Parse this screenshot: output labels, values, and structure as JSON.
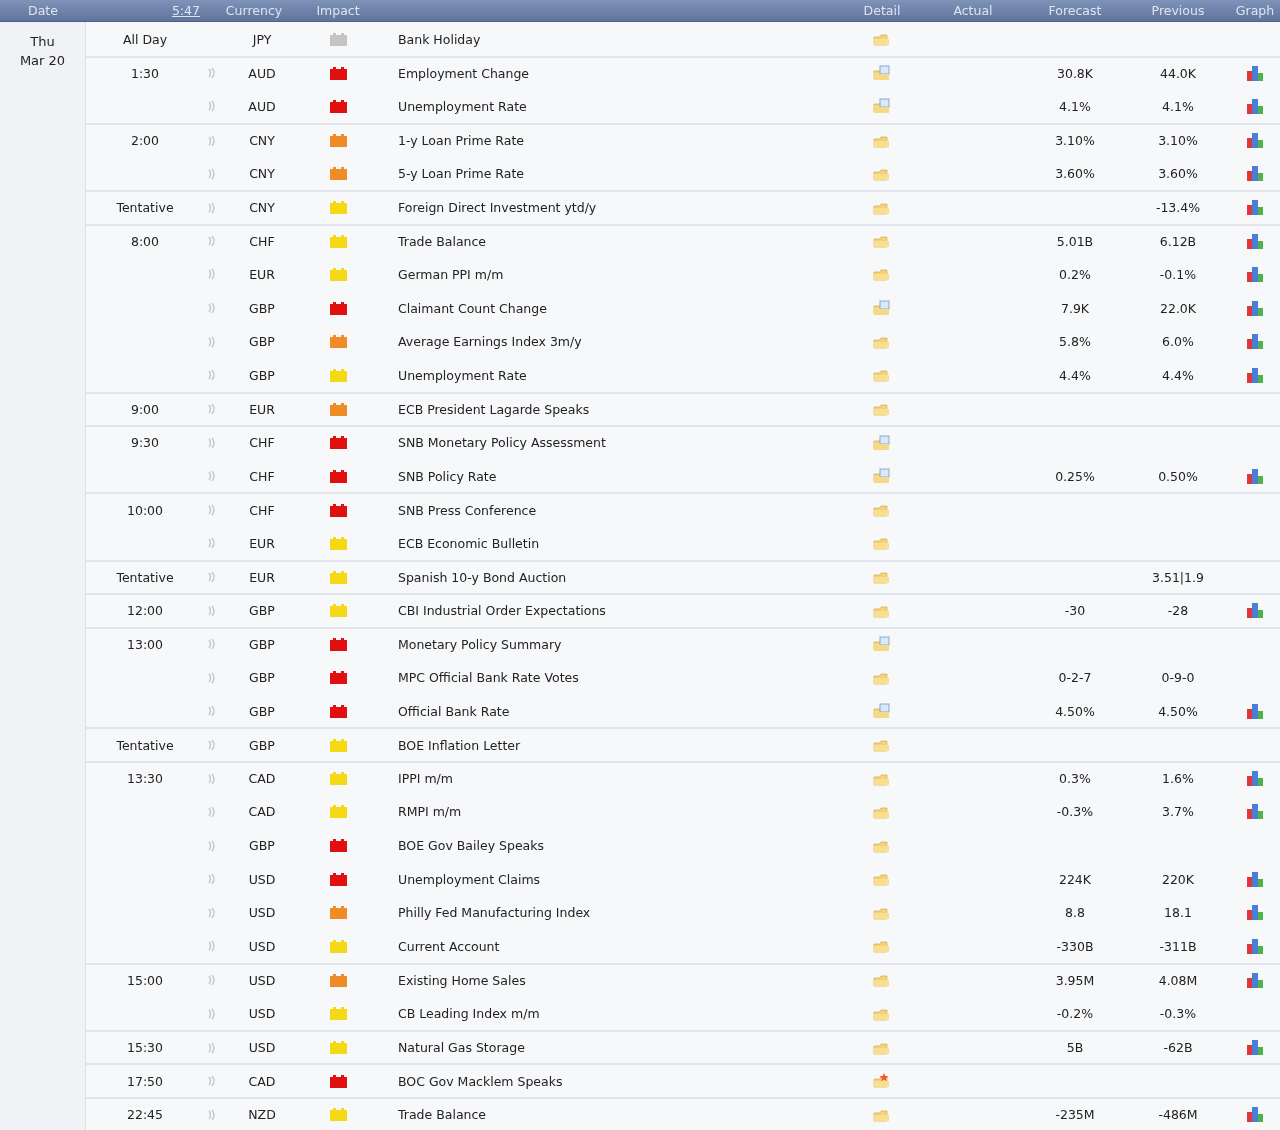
{
  "header": [
    {
      "label": "Date",
      "kind": "plain"
    },
    {
      "label": "5:47",
      "kind": "link"
    },
    {
      "label": "Currency",
      "kind": "plain"
    },
    {
      "label": "Impact",
      "kind": "plain"
    },
    {
      "label": "Detail",
      "kind": "plain"
    },
    {
      "label": "Actual",
      "kind": "plain"
    },
    {
      "label": "Forecast",
      "kind": "plain"
    },
    {
      "label": "Previous",
      "kind": "plain"
    },
    {
      "label": "Graph",
      "kind": "plain"
    }
  ],
  "day": {
    "weekday": "Thu",
    "date": "Mar 20"
  },
  "events": [
    {
      "time": "All Day",
      "alert": false,
      "currency": "JPY",
      "color": "#c4c4c4",
      "title": "Bank Holiday",
      "kind": "folder",
      "graph": false
    },
    {
      "time": "1:30",
      "alert": true,
      "currency": "AUD",
      "color": "#e01010",
      "title": "Employment Change",
      "kind": "folder-doc",
      "forecast": "30.8K",
      "previous": "44.0K",
      "graph": true
    },
    {
      "alert": true,
      "currency": "AUD",
      "color": "#e01010",
      "title": "Unemployment Rate",
      "kind": "folder-doc",
      "forecast": "4.1%",
      "previous": "4.1%",
      "graph": true
    },
    {
      "time": "2:00",
      "alert": true,
      "currency": "CNY",
      "color": "#f08c28",
      "title": "1-y Loan Prime Rate",
      "kind": "folder",
      "forecast": "3.10%",
      "previous": "3.10%",
      "graph": true
    },
    {
      "alert": true,
      "currency": "CNY",
      "color": "#f08c28",
      "title": "5-y Loan Prime Rate",
      "kind": "folder",
      "forecast": "3.60%",
      "previous": "3.60%",
      "graph": true
    },
    {
      "time": "Tentative",
      "alert": true,
      "currency": "CNY",
      "color": "#f5d816",
      "title": "Foreign Direct Investment ytd/y",
      "kind": "folder",
      "previous": "-13.4%",
      "graph": true
    },
    {
      "time": "8:00",
      "alert": true,
      "currency": "CHF",
      "color": "#f5d816",
      "title": "Trade Balance",
      "kind": "folder",
      "forecast": "5.01B",
      "previous": "6.12B",
      "graph": true
    },
    {
      "alert": true,
      "currency": "EUR",
      "color": "#f5d816",
      "title": "German PPI m/m",
      "kind": "folder",
      "forecast": "0.2%",
      "previous": "-0.1%",
      "graph": true
    },
    {
      "alert": true,
      "currency": "GBP",
      "color": "#e01010",
      "title": "Claimant Count Change",
      "kind": "folder-doc",
      "forecast": "7.9K",
      "previous": "22.0K",
      "graph": true
    },
    {
      "alert": true,
      "currency": "GBP",
      "color": "#f08c28",
      "title": "Average Earnings Index 3m/y",
      "kind": "folder",
      "forecast": "5.8%",
      "previous": "6.0%",
      "graph": true
    },
    {
      "alert": true,
      "currency": "GBP",
      "color": "#f5d816",
      "title": "Unemployment Rate",
      "kind": "folder",
      "forecast": "4.4%",
      "previous": "4.4%",
      "graph": true
    },
    {
      "time": "9:00",
      "alert": true,
      "currency": "EUR",
      "color": "#f08c28",
      "title": "ECB President Lagarde Speaks",
      "kind": "folder",
      "graph": false
    },
    {
      "time": "9:30",
      "alert": true,
      "currency": "CHF",
      "color": "#e01010",
      "title": "SNB Monetary Policy Assessment",
      "kind": "folder-doc",
      "graph": false
    },
    {
      "alert": true,
      "currency": "CHF",
      "color": "#e01010",
      "title": "SNB Policy Rate",
      "kind": "folder-doc",
      "forecast": "0.25%",
      "previous": "0.50%",
      "graph": true
    },
    {
      "time": "10:00",
      "alert": true,
      "currency": "CHF",
      "color": "#e01010",
      "title": "SNB Press Conference",
      "kind": "folder",
      "graph": false
    },
    {
      "alert": true,
      "currency": "EUR",
      "color": "#f5d816",
      "title": "ECB Economic Bulletin",
      "kind": "folder",
      "graph": false
    },
    {
      "time": "Tentative",
      "alert": true,
      "currency": "EUR",
      "color": "#f5d816",
      "title": "Spanish 10-y Bond Auction",
      "kind": "folder",
      "previous": "3.51|1.9",
      "graph": false
    },
    {
      "time": "12:00",
      "alert": true,
      "currency": "GBP",
      "color": "#f5d816",
      "title": "CBI Industrial Order Expectations",
      "kind": "folder",
      "forecast": "-30",
      "previous": "-28",
      "graph": true
    },
    {
      "time": "13:00",
      "alert": true,
      "currency": "GBP",
      "color": "#e01010",
      "title": "Monetary Policy Summary",
      "kind": "folder-doc",
      "graph": false
    },
    {
      "alert": true,
      "currency": "GBP",
      "color": "#e01010",
      "title": "MPC Official Bank Rate Votes",
      "kind": "folder",
      "forecast": "0-2-7",
      "previous": "0-9-0",
      "graph": false
    },
    {
      "alert": true,
      "currency": "GBP",
      "color": "#e01010",
      "title": "Official Bank Rate",
      "kind": "folder-doc",
      "forecast": "4.50%",
      "previous": "4.50%",
      "graph": true
    },
    {
      "time": "Tentative",
      "alert": true,
      "currency": "GBP",
      "color": "#f5d816",
      "title": "BOE Inflation Letter",
      "kind": "folder",
      "graph": false
    },
    {
      "time": "13:30",
      "alert": true,
      "currency": "CAD",
      "color": "#f5d816",
      "title": "IPPI m/m",
      "kind": "folder",
      "forecast": "0.3%",
      "previous": "1.6%",
      "graph": true
    },
    {
      "alert": true,
      "currency": "CAD",
      "color": "#f5d816",
      "title": "RMPI m/m",
      "kind": "folder",
      "forecast": "-0.3%",
      "previous": "3.7%",
      "graph": true
    },
    {
      "alert": true,
      "currency": "GBP",
      "color": "#e01010",
      "title": "BOE Gov Bailey Speaks",
      "kind": "folder",
      "graph": false
    },
    {
      "alert": true,
      "currency": "USD",
      "color": "#e01010",
      "title": "Unemployment Claims",
      "kind": "folder",
      "forecast": "224K",
      "previous": "220K",
      "graph": true
    },
    {
      "alert": true,
      "currency": "USD",
      "color": "#f08c28",
      "title": "Philly Fed Manufacturing Index",
      "kind": "folder",
      "forecast": "8.8",
      "previous": "18.1",
      "graph": true
    },
    {
      "alert": true,
      "currency": "USD",
      "color": "#f5d816",
      "title": "Current Account",
      "kind": "folder",
      "forecast": "-330B",
      "previous": "-311B",
      "graph": true
    },
    {
      "time": "15:00",
      "alert": true,
      "currency": "USD",
      "color": "#f08c28",
      "title": "Existing Home Sales",
      "kind": "folder",
      "forecast": "3.95M",
      "previous": "4.08M",
      "graph": true
    },
    {
      "alert": true,
      "currency": "USD",
      "color": "#f5d816",
      "title": "CB Leading Index m/m",
      "kind": "folder",
      "forecast": "-0.2%",
      "previous": "-0.3%",
      "graph": false
    },
    {
      "time": "15:30",
      "alert": true,
      "currency": "USD",
      "color": "#f5d816",
      "title": "Natural Gas Storage",
      "kind": "folder",
      "forecast": "5B",
      "previous": "-62B",
      "graph": true
    },
    {
      "time": "17:50",
      "alert": true,
      "currency": "CAD",
      "color": "#e01010",
      "title": "BOC Gov Macklem Speaks",
      "kind": "folder-star",
      "graph": false
    },
    {
      "time": "22:45",
      "alert": true,
      "currency": "NZD",
      "color": "#f5d816",
      "title": "Trade Balance",
      "kind": "folder",
      "forecast": "-235M",
      "previous": "-486M",
      "graph": true
    }
  ]
}
